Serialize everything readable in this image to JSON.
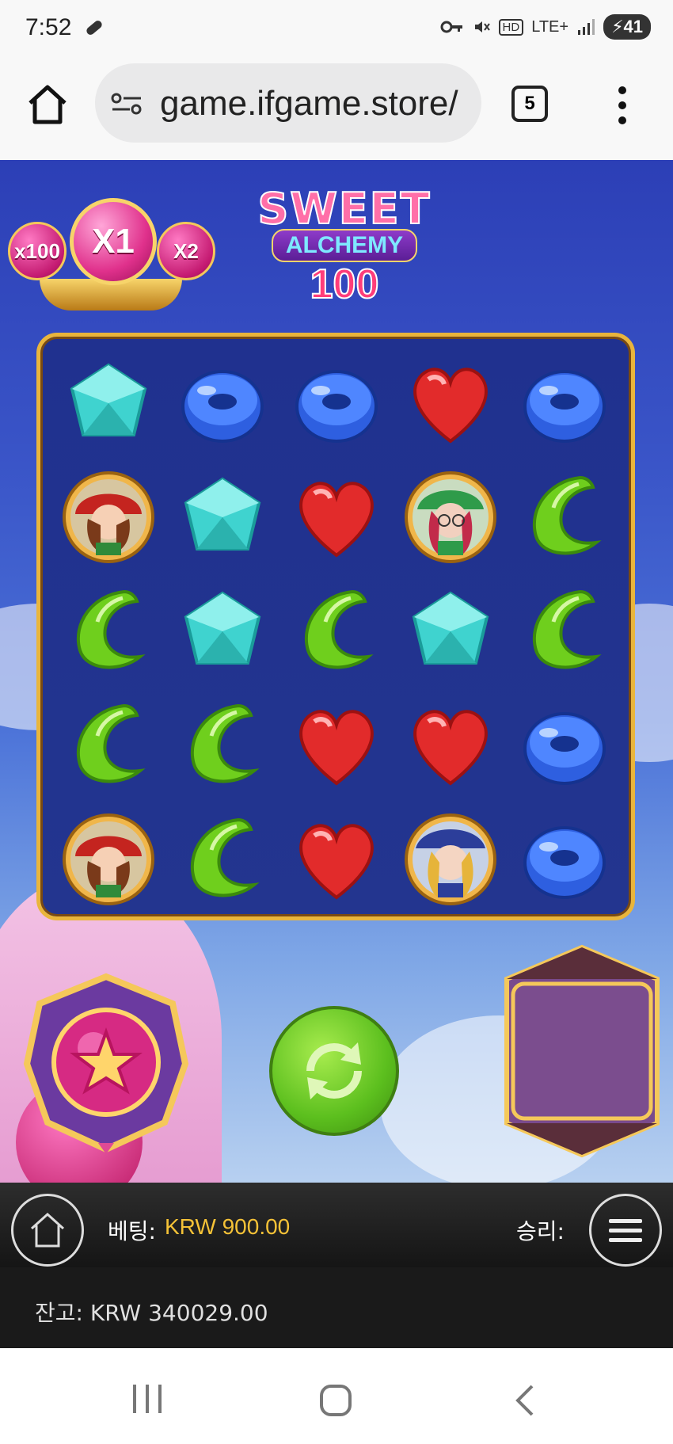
{
  "status_bar": {
    "time": "7:52",
    "indicators": [
      "HD",
      "LTE+"
    ],
    "battery": "41",
    "icons": [
      "pen-icon",
      "key-icon",
      "mute-icon",
      "signal-icon"
    ]
  },
  "browser": {
    "url": "game.ifgame.store/",
    "tab_count": "5",
    "icons": [
      "home-icon",
      "site-settings-icon",
      "more-vert-icon"
    ]
  },
  "game": {
    "multipliers": {
      "left": "x100",
      "center": "X1",
      "right": "X2"
    },
    "logo": {
      "line1": "SWEET",
      "line2": "ALCHEMY",
      "line3": "100"
    },
    "grid": [
      [
        "cyan-cube",
        "blue-ring",
        "blue-ring",
        "red-heart",
        "blue-ring"
      ],
      [
        "red-witch",
        "cyan-cube",
        "red-heart",
        "green-witch",
        "green-jelly"
      ],
      [
        "green-jelly",
        "cyan-cube",
        "green-jelly",
        "cyan-cube",
        "green-jelly"
      ],
      [
        "green-jelly",
        "green-jelly",
        "red-heart",
        "red-heart",
        "blue-ring"
      ],
      [
        "red-witch",
        "green-jelly",
        "red-heart",
        "blue-witch",
        "blue-ring"
      ]
    ]
  },
  "bottom_bar": {
    "bet_label": "베팅:",
    "bet_value": "KRW 900.00",
    "win_label": "승리:"
  },
  "balance": {
    "text": "잔고: KRW 340029.00"
  },
  "colors": {
    "accent_gold": "#f5c237",
    "board_frame": "#e9b53c",
    "spin_green": "#5cbf1e"
  }
}
